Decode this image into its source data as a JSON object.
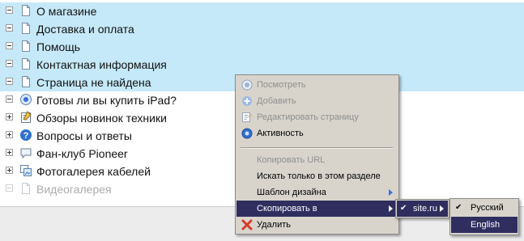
{
  "tree": {
    "items": [
      {
        "label": "О магазине",
        "expander": "minus",
        "icon": "page-icon",
        "selected": true,
        "disabled": false
      },
      {
        "label": "Доставка и оплата",
        "expander": "minus",
        "icon": "page-icon",
        "selected": true,
        "disabled": false
      },
      {
        "label": "Помощь",
        "expander": "minus",
        "icon": "page-icon",
        "selected": true,
        "disabled": false
      },
      {
        "label": "Контактная информация",
        "expander": "minus",
        "icon": "page-icon",
        "selected": true,
        "disabled": false
      },
      {
        "label": "Страница не найдена",
        "expander": "minus",
        "icon": "page-icon",
        "selected": true,
        "disabled": false
      },
      {
        "label": "Готовы ли вы купить iPad?",
        "expander": "minus",
        "icon": "poll-icon",
        "selected": false,
        "disabled": false
      },
      {
        "label": "Обзоры новинок техники",
        "expander": "plus",
        "icon": "blog-icon",
        "selected": false,
        "disabled": false
      },
      {
        "label": "Вопросы и ответы",
        "expander": "plus",
        "icon": "faq-icon",
        "selected": false,
        "disabled": false
      },
      {
        "label": "Фан-клуб Pioneer",
        "expander": "plus",
        "icon": "forum-icon",
        "selected": false,
        "disabled": false
      },
      {
        "label": "Фотогалерея кабелей",
        "expander": "plus",
        "icon": "gallery-icon",
        "selected": false,
        "disabled": false
      },
      {
        "label": "Видеогалерея",
        "expander": "minus",
        "icon": "page-icon",
        "selected": false,
        "disabled": true
      }
    ]
  },
  "context_menu": {
    "items": [
      {
        "label": "Посмотреть",
        "icon": "view-icon",
        "disabled": true
      },
      {
        "label": "Добавить",
        "icon": "add-icon",
        "disabled": true
      },
      {
        "label": "Редактировать страницу",
        "icon": "edit-icon",
        "disabled": true
      },
      {
        "label": "Активность",
        "icon": "activity-icon",
        "disabled": false
      },
      {
        "label": "Копировать URL",
        "icon": "",
        "disabled": true
      },
      {
        "label": "Искать только в этом разделе",
        "icon": "",
        "disabled": false
      },
      {
        "label": "Шаблон дизайна",
        "icon": "",
        "disabled": false,
        "submenu": true
      },
      {
        "label": "Скопировать в",
        "icon": "",
        "disabled": false,
        "submenu": true,
        "highlighted": true
      },
      {
        "label": "Удалить",
        "icon": "delete-icon",
        "disabled": false
      }
    ]
  },
  "submenu_site": {
    "label": "site.ru",
    "checked": true
  },
  "submenu_lang": {
    "items": [
      {
        "label": "Русский",
        "checked": true,
        "highlighted": false
      },
      {
        "label": "English",
        "checked": false,
        "highlighted": true
      }
    ]
  },
  "colors": {
    "selection": "#c5e9f9",
    "menu_bg": "#d8d4cc",
    "menu_highlight": "#2f2e5f",
    "submenu_arrow": "#3a6fd8"
  }
}
